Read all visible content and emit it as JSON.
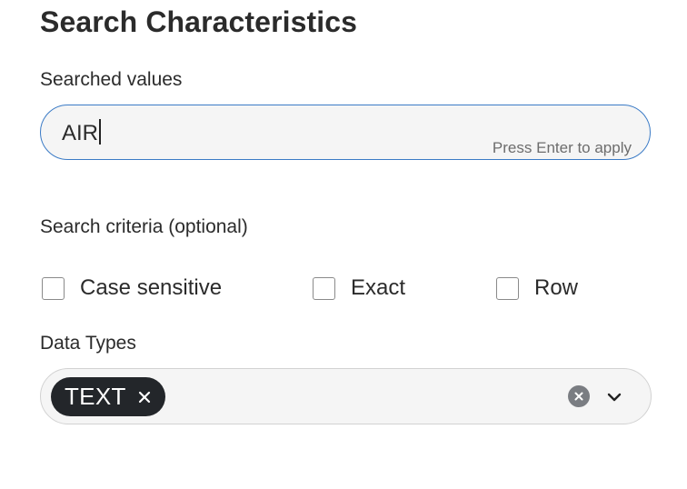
{
  "title": "Search Characteristics",
  "searched_values": {
    "label": "Searched values",
    "value": "AIR",
    "hint": "Press Enter to apply"
  },
  "criteria": {
    "label": "Search criteria (optional)",
    "options": [
      {
        "label": "Case sensitive",
        "checked": false
      },
      {
        "label": "Exact",
        "checked": false
      },
      {
        "label": "Row",
        "checked": false
      }
    ]
  },
  "data_types": {
    "label": "Data Types",
    "selected": [
      {
        "label": "TEXT"
      }
    ],
    "icons": {
      "chip_remove": "close-icon",
      "clear": "clear-circle-icon",
      "dropdown": "chevron-down-icon"
    }
  },
  "colors": {
    "focus_border": "#3b7bc6",
    "chip_background": "#23262a",
    "field_background": "#f5f5f5"
  }
}
